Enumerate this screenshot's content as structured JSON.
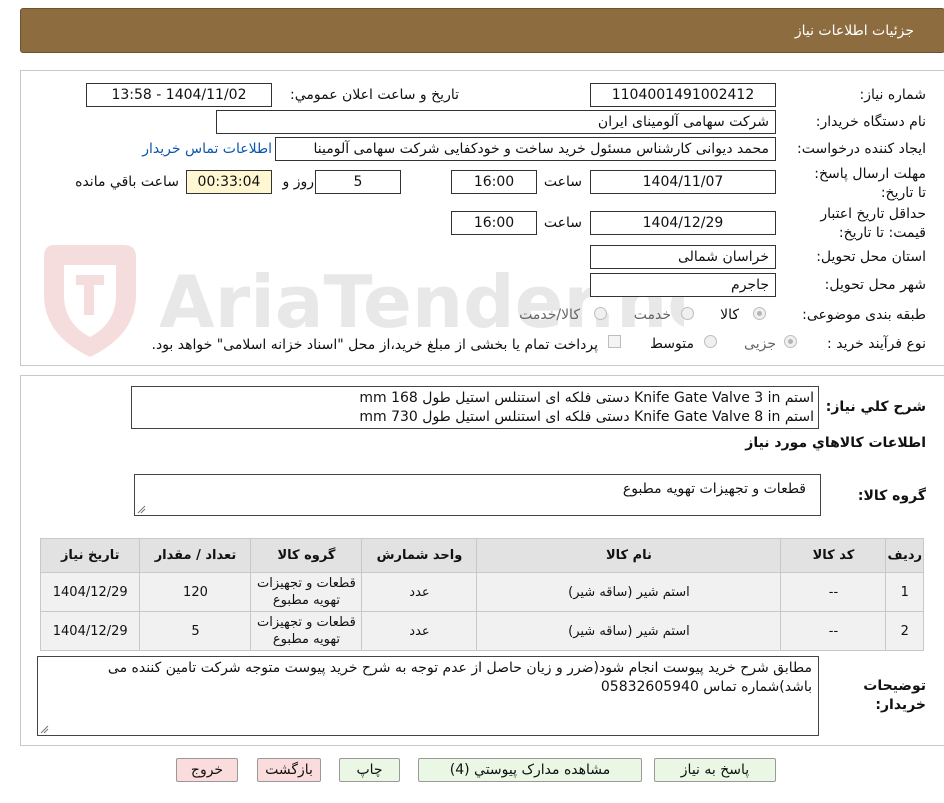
{
  "header": {
    "title": "جزئیات اطلاعات نیاز"
  },
  "watermark": {
    "text": "AriaTender.net"
  },
  "form": {
    "need_number_label": "شماره نیاز:",
    "need_number": "1104001491002412",
    "announce_label": "تاریخ و ساعت اعلان عمومي:",
    "announce_value": "1404/11/02 - 13:58",
    "buyer_org_label": "نام دستگاه خریدار:",
    "buyer_org": "شرکت سهامی آلومینای ایران",
    "requester_label": "ایجاد کننده درخواست:",
    "requester": "محمد دیوانی کارشناس مسئول خرید ساخت و خودکفایی شرکت سهامی آلومینا",
    "contact_link": "اطلاعات تماس خریدار",
    "deadline_label": "مهلت ارسال پاسخ: تا تاریخ:",
    "deadline_date": "1404/11/07",
    "time_label": "ساعت",
    "deadline_time": "16:00",
    "days_value": "5",
    "days_label": "روز و",
    "remaining_value": "00:33:04",
    "remaining_label": "ساعت باقي مانده",
    "validity_label": "حداقل تاریخ اعتبار قیمت: تا تاریخ:",
    "validity_date": "1404/12/29",
    "validity_time": "16:00",
    "province_label": "استان محل تحویل:",
    "province": "خراسان شمالی",
    "city_label": "شهر محل تحویل:",
    "city": "جاجرم",
    "category_label": "طبقه بندی موضوعی:",
    "category_options": [
      "کالا",
      "خدمت",
      "کالا/خدمت"
    ],
    "category_selected": "کالا",
    "process_label": "نوع فرآیند خرید :",
    "process_options": [
      "جزیی",
      "متوسط"
    ],
    "process_selected": "جزیی",
    "payment_note": "پرداخت تمام یا بخشی از مبلغ خرید،از محل \"اسناد خزانه اسلامی\" خواهد بود."
  },
  "description": {
    "label": "شرح کلي نیاز:",
    "line1": "استم Knife Gate Valve 3 in دستی فلکه ای استنلس استیل طول 168 mm",
    "line2": "استم Knife Gate Valve 8 in دستی فلکه ای استنلس استیل طول 730 mm"
  },
  "goods": {
    "section_title": "اطلاعات کالاهاي مورد نیاز",
    "group_label": "گروه کالا:",
    "group_value": "قطعات و تجهیزات تهویه مطبوع",
    "columns": [
      "ردیف",
      "کد کالا",
      "نام کالا",
      "واحد شمارش",
      "گروه کالا",
      "تعداد / مقدار",
      "تاریخ نیاز"
    ],
    "rows": [
      {
        "row": "1",
        "code": "--",
        "name": "استم شیر (ساقه شیر)",
        "unit": "عدد",
        "group": "قطعات و تجهیزات تهویه مطبوع",
        "qty": "120",
        "date": "1404/12/29"
      },
      {
        "row": "2",
        "code": "--",
        "name": "استم شیر (ساقه شیر)",
        "unit": "عدد",
        "group": "قطعات و تجهیزات تهویه مطبوع",
        "qty": "5",
        "date": "1404/12/29"
      }
    ]
  },
  "buyer_notes": {
    "label": "توضیحات خریدار:",
    "text": "مطابق شرح خرید پیوست انجام شود(ضرر و زیان حاصل از عدم توجه به شرح خرید پیوست متوجه شرکت تامین کننده می باشد)شماره تماس 05832605940"
  },
  "buttons": {
    "reply": "پاسخ به نیاز",
    "attachments": "مشاهده مدارک پیوستي (4)",
    "print": "چاپ",
    "back": "بازگشت",
    "exit": "خروج"
  },
  "colors": {
    "header_bg": "#8d6d3f",
    "link": "#0b57b0",
    "yellow_box": "#fff7d2",
    "green_button": "#e9f7e4",
    "pink_button": "#fbdcdc"
  }
}
